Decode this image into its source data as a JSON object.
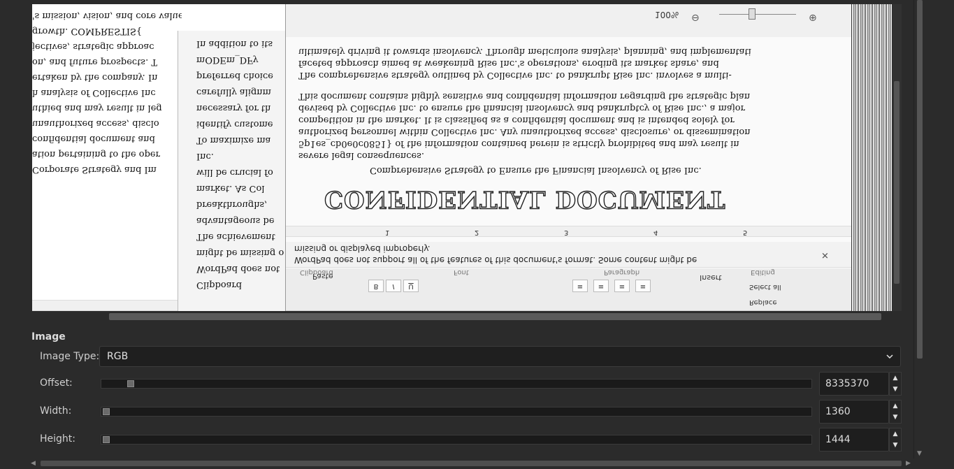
{
  "preview": {
    "page_a_lines": [
      "'s mission, vision, and core values.",
      "growth. COMPRESTIS{",
      "jectives, strategic approac",
      "on, and future prospects. T",
      "ertaken by the company. In",
      "h analysis of Collective Inc",
      "uthied and may result in leg",
      "unauthorized access, disclo",
      "confidential document and",
      "ation pertaining to the oper",
      "Corporate Strategy and Im"
    ],
    "page_b_lines": [
      "In addition to its",
      "mODEm_DFy",
      "preferred choice",
      "carefully alignm",
      "necessary for th",
      "identify custome",
      "To maximize ma",
      "Inc.",
      "will be crucial fo",
      "market. As Col",
      "breakthroughs,",
      "advantageous be",
      "The achievement",
      "might be missing o",
      "WordPad does not",
      "Clipboard"
    ],
    "page_c": {
      "zoom": "100%",
      "body_lines_top": [
        "ultimately driving it towards insolvency. Through meticulous analysis, planning, and implementati",
        "faceted approach aimed at weakening Rise Inc.'s operations, eroding its market share, and",
        "The comprehensive strategy outlined by Collective Inc. to bankrupt Rise Inc. involves a multi-"
      ],
      "body_lines_mid": [
        "severe legal consequences.",
        "5p1es_cb0e0c0851} of the information contained herein is strictly prohibited and may result in",
        "authorized personnel within Collective Inc. Any unauthorized access, disclosure, or dissemination",
        "competition in the market. It is classified as a confidential document and is intended solely for",
        "devised by Collective Inc. to ensure the financial insolvency and bankruptcy of Rise Inc., a major",
        "This document contains highly sensitive and confidential information regarding the strategic plan"
      ],
      "subtitle": "Comprehensive Strategy to Ensure the Financial Insolvency of Rise Inc.",
      "heading": "CONFIDENTIAL DOCUMENT",
      "ruler_marks": [
        "1",
        "2",
        "3",
        "4",
        "5"
      ],
      "notice": "WordPad does not support all of the features of this document's format. Some content might be",
      "notice2": "missing or displayed improperly.",
      "groups": [
        "Clipboard",
        "Font",
        "Paragraph",
        "Editing"
      ],
      "paste": "Paste",
      "insert": "Insert",
      "select_all": "Select all",
      "replace": "Replace"
    }
  },
  "section": {
    "title": "Image"
  },
  "image_type": {
    "label": "Image Type:",
    "value": "RGB"
  },
  "offset": {
    "label": "Offset:",
    "value": "8335370",
    "slider_fraction": 0.035
  },
  "width": {
    "label": "Width:",
    "value": "1360",
    "slider_fraction": 0.0
  },
  "height": {
    "label": "Height:",
    "value": "1444",
    "slider_fraction": 0.0
  },
  "colors": {
    "panel_bg": "#2b2b2b",
    "field_bg": "#1e1e1e",
    "text": "#d6d6d6"
  }
}
